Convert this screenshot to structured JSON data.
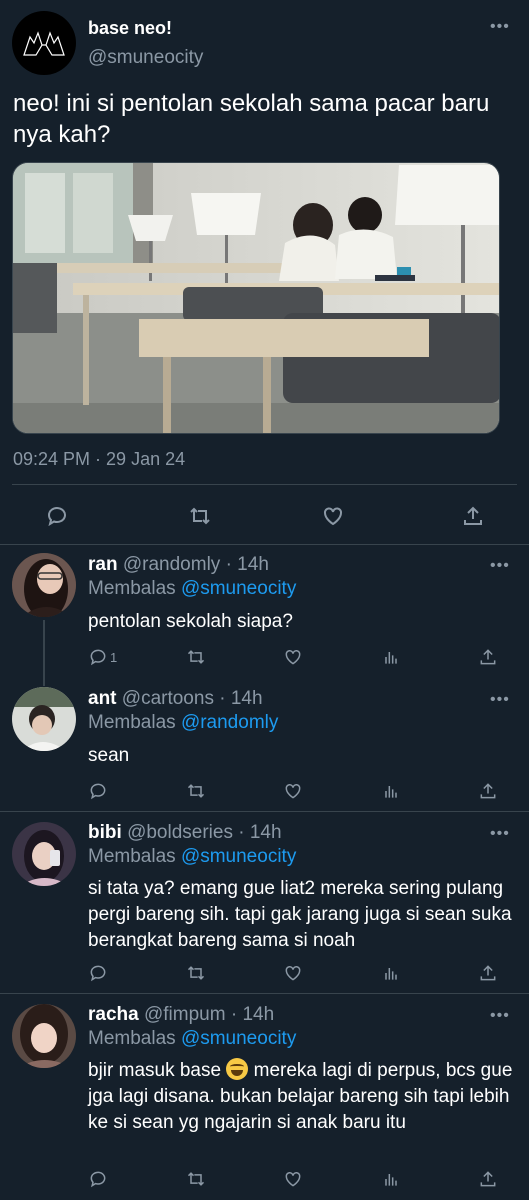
{
  "main_tweet": {
    "display_name": "base neo!",
    "handle": "@smuneocity",
    "text": "neo! ini si pentolan sekolah sama pacar baru nya kah?",
    "timestamp": "09:24 PM · 29 Jan 24",
    "more_icon": "more-horizontal-icon",
    "actions": [
      "reply-icon",
      "retweet-icon",
      "like-icon",
      "share-icon"
    ]
  },
  "replies": [
    {
      "name": "ran",
      "handle": "@randomly",
      "time": "· 14h",
      "replying_label": "Membalas",
      "replying_to": "@smuneocity",
      "text": "pentolan sekolah siapa?",
      "reply_count": "1"
    },
    {
      "name": "ant",
      "handle": "@cartoons",
      "time": "· 14h",
      "replying_label": "Membalas",
      "replying_to": "@randomly",
      "text": "sean"
    },
    {
      "name": "bibi",
      "handle": "@boldseries",
      "time": "· 14h",
      "replying_label": "Membalas",
      "replying_to": "@smuneocity",
      "text": "si tata ya? emang gue liat2 mereka sering pulang pergi bareng sih. tapi gak jarang juga si sean suka berangkat bareng sama si noah"
    },
    {
      "name": "racha",
      "handle": "@fimpum",
      "time": "· 14h",
      "replying_label": "Membalas",
      "replying_to": "@smuneocity",
      "text_before_emoji": "bjir masuk base",
      "text_after_emoji": "mereka lagi di perpus, bcs gue jga lagi disana. bukan belajar bareng sih tapi lebih ke si sean yg ngajarin si anak baru itu"
    }
  ],
  "colors": {
    "background": "#15202b",
    "divider": "#38444d",
    "secondary_text": "#8b98a5",
    "mention": "#1d9bf0"
  }
}
